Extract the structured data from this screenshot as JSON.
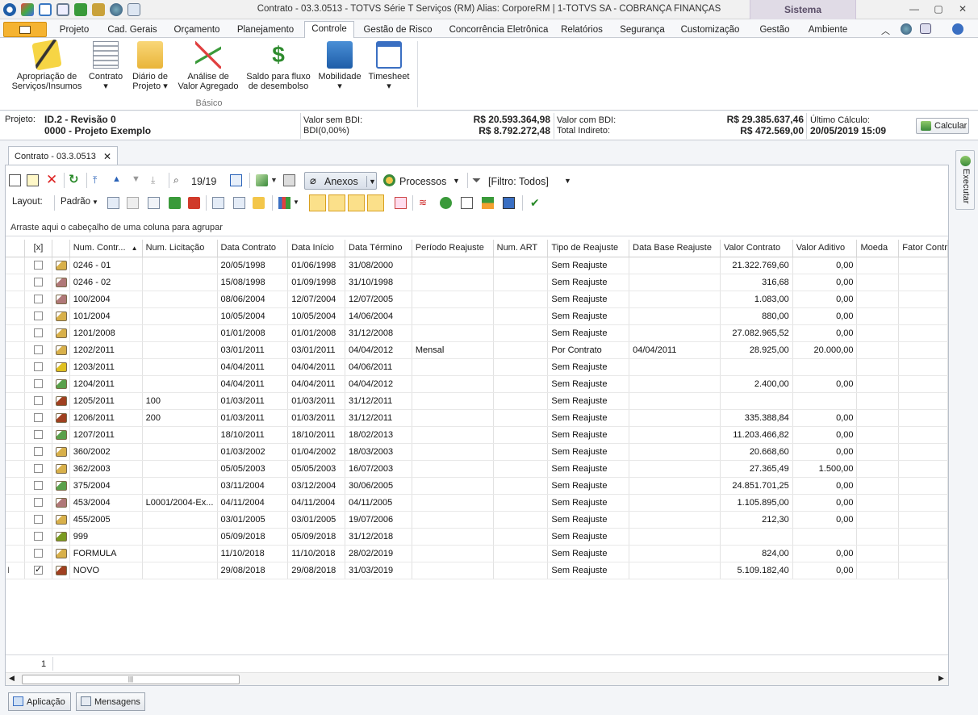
{
  "window": {
    "title": "Contrato - 03.3.0513 - TOTVS Série T Serviços (RM) Alias: CorporeRM | 1-TOTVS SA - COBRANÇA FINANÇAS",
    "context_tab": "Sistema"
  },
  "menu_tabs": [
    {
      "label": "Projeto"
    },
    {
      "label": "Cad. Gerais"
    },
    {
      "label": "Orçamento"
    },
    {
      "label": "Planejamento"
    },
    {
      "label": "Controle",
      "active": true
    },
    {
      "label": "Gestão de Risco"
    },
    {
      "label": "Concorrência Eletrônica"
    },
    {
      "label": "Relatórios"
    },
    {
      "label": "Segurança"
    },
    {
      "label": "Customização"
    },
    {
      "label": "Gestão"
    },
    {
      "label": "Ambiente"
    }
  ],
  "ribbon": {
    "group_label": "Básico",
    "buttons": [
      {
        "line1": "Apropriação de",
        "line2": "Serviços/Insumos",
        "icon": "pencil-icon"
      },
      {
        "line1": "Contrato",
        "line2": "▾",
        "icon": "contract-icon"
      },
      {
        "line1": "Diário de",
        "line2": "Projeto ▾",
        "icon": "folder-icon"
      },
      {
        "line1": "Análise de",
        "line2": "Valor Agregado",
        "icon": "chart-icon"
      },
      {
        "line1": "Saldo para fluxo",
        "line2": "de desembolso",
        "icon": "dollar-icon"
      },
      {
        "line1": "Mobilidade",
        "line2": "▾",
        "icon": "mobile-icon"
      },
      {
        "line1": "Timesheet",
        "line2": "▾",
        "icon": "calendar-icon"
      }
    ]
  },
  "project": {
    "label": "Projeto:",
    "id": "ID.2 - Revisão 0",
    "name": "0000 - Projeto Exemplo",
    "valor_sem_bdi_label": "Valor sem BDI:",
    "valor_sem_bdi": "R$ 20.593.364,98",
    "bdi_label": "BDI(0,00%)",
    "bdi_value": "R$ 8.792.272,48",
    "valor_com_bdi_label": "Valor com BDI:",
    "valor_com_bdi": "R$ 29.385.637,46",
    "total_indireto_label": "Total Indireto:",
    "total_indireto": "R$ 472.569,00",
    "ultimo_calculo_label": "Último Cálculo:",
    "ultimo_calculo": "20/05/2019 15:09",
    "calcular_label": "Calcular"
  },
  "doc_tab": {
    "label": "Contrato - 03.3.0513",
    "close": "✕"
  },
  "toolbar": {
    "record_counter": "19/19",
    "anexos_label": "Anexos",
    "processos_label": "Processos",
    "filtro_label": "[Filtro: Todos]",
    "layout_label": "Layout:",
    "padrao_label": "Padrão"
  },
  "group_hint": "Arraste aqui o cabeçalho de uma coluna para agrupar",
  "grid": {
    "columns": [
      "[x]",
      "",
      "Num. Contr...",
      "Num. Licitação",
      "Data Contrato",
      "Data Início",
      "Data Término",
      "Período Reajuste",
      "Num. ART",
      "Tipo de Reajuste",
      "Data Base Reajuste",
      "Valor Contrato",
      "Valor Aditivo",
      "Moeda",
      "Fator Contr"
    ],
    "sort_indicator": "▲",
    "rows": [
      {
        "num": "0246 - 01",
        "lic": "",
        "dc": "20/05/1998",
        "di": "01/06/1998",
        "dt": "31/08/2000",
        "per": "",
        "art": "",
        "tipo": "Sem Reajuste",
        "dbr": "",
        "vc": "21.322.769,60",
        "va": "0,00",
        "icon": "#d8b04a"
      },
      {
        "num": "0246 - 02",
        "lic": "",
        "dc": "15/08/1998",
        "di": "01/09/1998",
        "dt": "31/10/1998",
        "per": "",
        "art": "",
        "tipo": "Sem Reajuste",
        "dbr": "",
        "vc": "316,68",
        "va": "0,00",
        "icon": "#b07878"
      },
      {
        "num": "100/2004",
        "lic": "",
        "dc": "08/06/2004",
        "di": "12/07/2004",
        "dt": "12/07/2005",
        "per": "",
        "art": "",
        "tipo": "Sem Reajuste",
        "dbr": "",
        "vc": "1.083,00",
        "va": "0,00",
        "icon": "#b07878"
      },
      {
        "num": "101/2004",
        "lic": "",
        "dc": "10/05/2004",
        "di": "10/05/2004",
        "dt": "14/06/2004",
        "per": "",
        "art": "",
        "tipo": "Sem Reajuste",
        "dbr": "",
        "vc": "880,00",
        "va": "0,00",
        "icon": "#d8b04a"
      },
      {
        "num": "1201/2008",
        "lic": "",
        "dc": "01/01/2008",
        "di": "01/01/2008",
        "dt": "31/12/2008",
        "per": "",
        "art": "",
        "tipo": "Sem Reajuste",
        "dbr": "",
        "vc": "27.082.965,52",
        "va": "0,00",
        "icon": "#d8b04a"
      },
      {
        "num": "1202/2011",
        "lic": "",
        "dc": "03/01/2011",
        "di": "03/01/2011",
        "dt": "04/04/2012",
        "per": "Mensal",
        "art": "",
        "tipo": "Por Contrato",
        "dbr": "04/04/2011",
        "vc": "28.925,00",
        "va": "20.000,00",
        "icon": "#d8b04a"
      },
      {
        "num": "1203/2011",
        "lic": "",
        "dc": "04/04/2011",
        "di": "04/04/2011",
        "dt": "04/06/2011",
        "per": "",
        "art": "",
        "tipo": "Sem Reajuste",
        "dbr": "",
        "vc": "",
        "va": "",
        "icon": "#e0c020"
      },
      {
        "num": "1204/2011",
        "lic": "",
        "dc": "04/04/2011",
        "di": "04/04/2011",
        "dt": "04/04/2012",
        "per": "",
        "art": "",
        "tipo": "Sem Reajuste",
        "dbr": "",
        "vc": "2.400,00",
        "va": "0,00",
        "icon": "#5aa04a"
      },
      {
        "num": "1205/2011",
        "lic": "100",
        "dc": "01/03/2011",
        "di": "01/03/2011",
        "dt": "31/12/2011",
        "per": "",
        "art": "",
        "tipo": "Sem Reajuste",
        "dbr": "",
        "vc": "",
        "va": "",
        "icon": "#a04020"
      },
      {
        "num": "1206/2011",
        "lic": "200",
        "dc": "01/03/2011",
        "di": "01/03/2011",
        "dt": "31/12/2011",
        "per": "",
        "art": "",
        "tipo": "Sem Reajuste",
        "dbr": "",
        "vc": "335.388,84",
        "va": "0,00",
        "icon": "#a04020"
      },
      {
        "num": "1207/2011",
        "lic": "",
        "dc": "18/10/2011",
        "di": "18/10/2011",
        "dt": "18/02/2013",
        "per": "",
        "art": "",
        "tipo": "Sem Reajuste",
        "dbr": "",
        "vc": "11.203.466,82",
        "va": "0,00",
        "icon": "#5aa04a"
      },
      {
        "num": "360/2002",
        "lic": "",
        "dc": "01/03/2002",
        "di": "01/04/2002",
        "dt": "18/03/2003",
        "per": "",
        "art": "",
        "tipo": "Sem Reajuste",
        "dbr": "",
        "vc": "20.668,60",
        "va": "0,00",
        "icon": "#d8b04a"
      },
      {
        "num": "362/2003",
        "lic": "",
        "dc": "05/05/2003",
        "di": "05/05/2003",
        "dt": "16/07/2003",
        "per": "",
        "art": "",
        "tipo": "Sem Reajuste",
        "dbr": "",
        "vc": "27.365,49",
        "va": "1.500,00",
        "icon": "#d8b04a"
      },
      {
        "num": "375/2004",
        "lic": "",
        "dc": "03/11/2004",
        "di": "03/12/2004",
        "dt": "30/06/2005",
        "per": "",
        "art": "",
        "tipo": "Sem Reajuste",
        "dbr": "",
        "vc": "24.851.701,25",
        "va": "0,00",
        "icon": "#5aa04a"
      },
      {
        "num": "453/2004",
        "lic": "L0001/2004-Ex...",
        "dc": "04/11/2004",
        "di": "04/11/2004",
        "dt": "04/11/2005",
        "per": "",
        "art": "",
        "tipo": "Sem Reajuste",
        "dbr": "",
        "vc": "1.105.895,00",
        "va": "0,00",
        "icon": "#b07878"
      },
      {
        "num": "455/2005",
        "lic": "",
        "dc": "03/01/2005",
        "di": "03/01/2005",
        "dt": "19/07/2006",
        "per": "",
        "art": "",
        "tipo": "Sem Reajuste",
        "dbr": "",
        "vc": "212,30",
        "va": "0,00",
        "icon": "#d8b04a"
      },
      {
        "num": "999",
        "lic": "",
        "dc": "05/09/2018",
        "di": "05/09/2018",
        "dt": "31/12/2018",
        "per": "",
        "art": "",
        "tipo": "Sem Reajuste",
        "dbr": "",
        "vc": "",
        "va": "",
        "icon": "#7a9a20"
      },
      {
        "num": "FORMULA",
        "lic": "",
        "dc": "11/10/2018",
        "di": "11/10/2018",
        "dt": "28/02/2019",
        "per": "",
        "art": "",
        "tipo": "Sem Reajuste",
        "dbr": "",
        "vc": "824,00",
        "va": "0,00",
        "icon": "#d8b04a"
      },
      {
        "num": "NOVO",
        "lic": "",
        "dc": "29/08/2018",
        "di": "29/08/2018",
        "dt": "31/03/2019",
        "per": "",
        "art": "",
        "tipo": "Sem Reajuste",
        "dbr": "",
        "vc": "5.109.182,40",
        "va": "0,00",
        "icon": "#a04020",
        "checked": true
      }
    ]
  },
  "footer_count": "1",
  "executar_label": "Executar",
  "bottom_tabs": [
    {
      "label": "Aplicação"
    },
    {
      "label": "Mensagens"
    }
  ]
}
